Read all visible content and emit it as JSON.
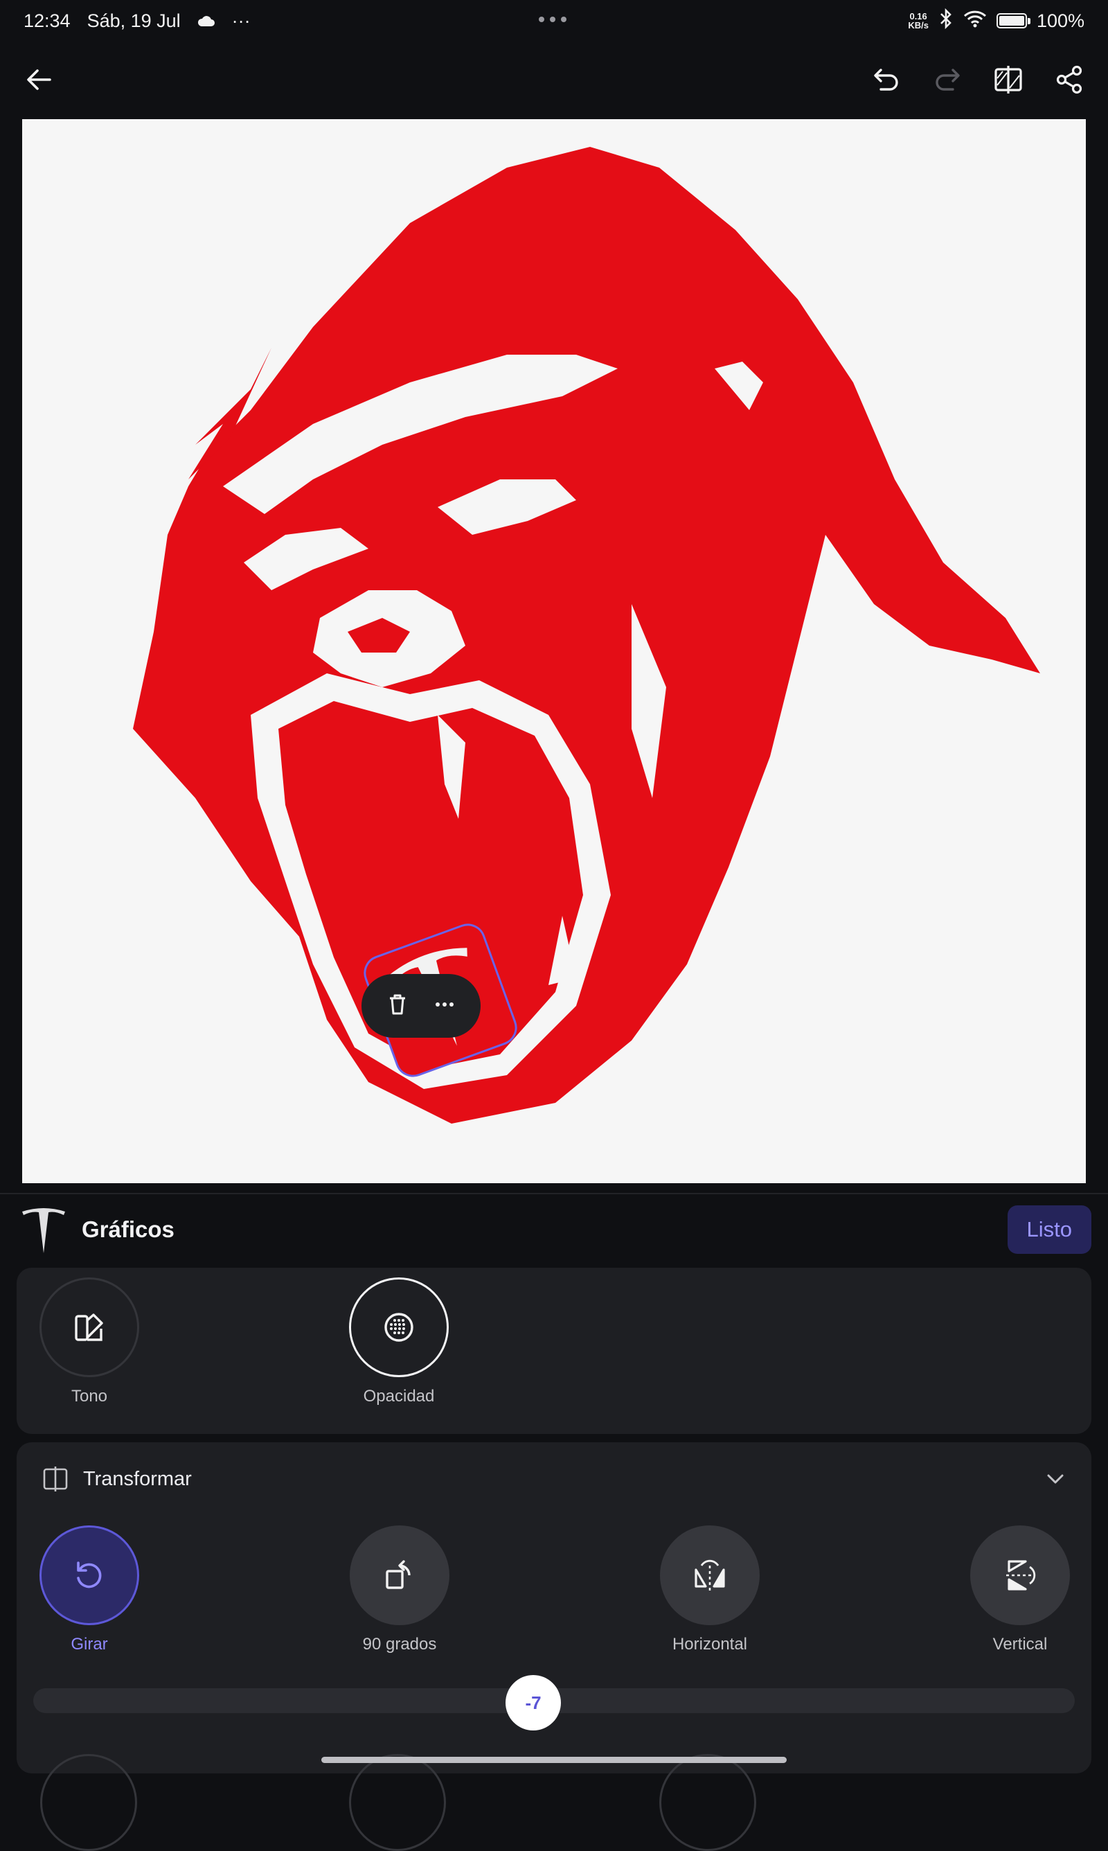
{
  "status_bar": {
    "time": "12:34",
    "date": "Sáb, 19 Jul",
    "more": "···",
    "net_speed_value": "0.16",
    "net_speed_unit": "KB/s",
    "battery": "100%"
  },
  "toolbar": {
    "back": "back-arrow-icon",
    "undo": "undo-icon",
    "redo": "redo-icon",
    "compare": "compare-icon",
    "share": "share-icon"
  },
  "canvas": {
    "background_color": "#f6f6f6",
    "artwork_color": "#e40d16",
    "selection_color": "#6a63e8",
    "sticker_rotation_deg": -7
  },
  "context_menu": {
    "delete": "trash-icon",
    "more": "more-horizontal-icon"
  },
  "sheet": {
    "title": "Gráficos",
    "done_label": "Listo"
  },
  "adjust_tools": [
    {
      "label": "Tono",
      "icon": "tone-icon"
    },
    {
      "label": "Opacidad",
      "icon": "opacity-icon"
    }
  ],
  "transform": {
    "title": "Transformar",
    "tools": [
      {
        "label": "Girar",
        "icon": "rotate-icon",
        "active": true
      },
      {
        "label": "90 grados",
        "icon": "rotate-90-icon"
      },
      {
        "label": "Horizontal",
        "icon": "flip-horizontal-icon"
      },
      {
        "label": "Vertical",
        "icon": "flip-vertical-icon"
      }
    ],
    "slider_value": "-7"
  }
}
